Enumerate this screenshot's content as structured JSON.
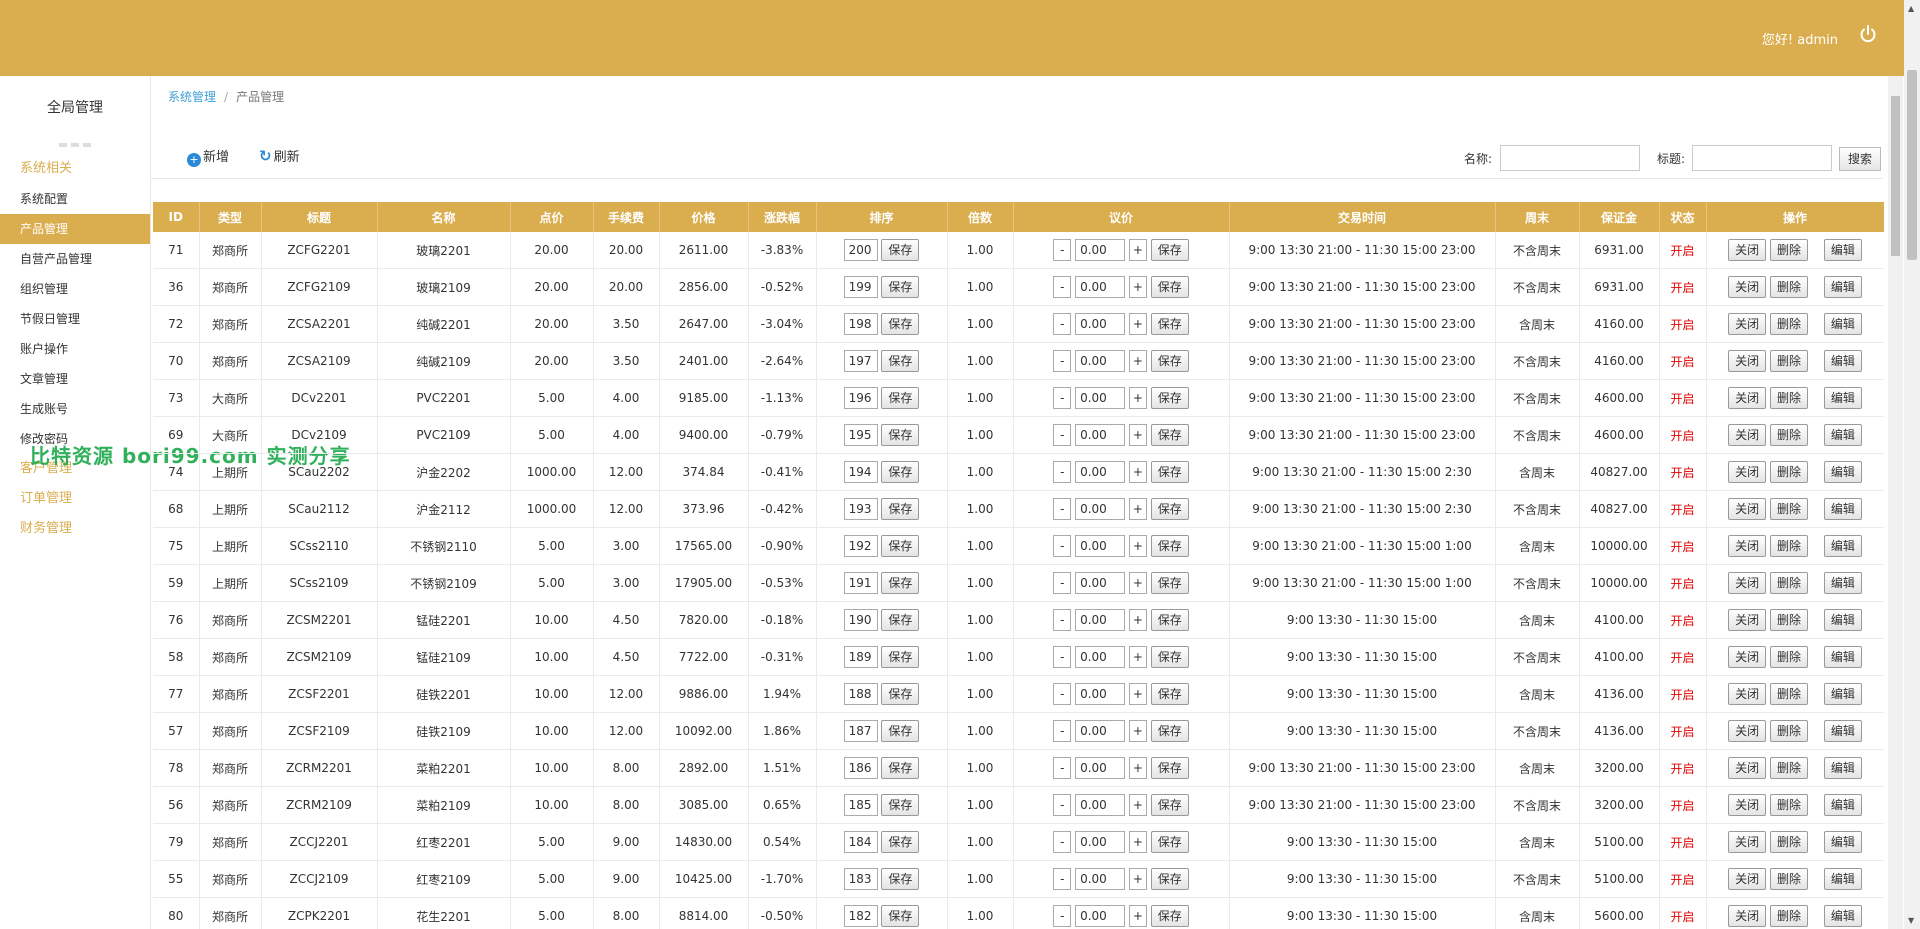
{
  "header": {
    "greeting": "您好! admin",
    "colors": {
      "accent": "#daae4f",
      "link": "#3f9fd6",
      "status_on": "#e10000"
    }
  },
  "sidebar": {
    "title": "全局管理",
    "groups": [
      {
        "label": "系统相关",
        "items": [
          {
            "label": "系统配置"
          },
          {
            "label": "产品管理",
            "active": true
          },
          {
            "label": "自营产品管理"
          },
          {
            "label": "组织管理"
          },
          {
            "label": "节假日管理"
          },
          {
            "label": "账户操作"
          },
          {
            "label": "文章管理"
          },
          {
            "label": "生成账号"
          },
          {
            "label": "修改密码"
          }
        ]
      },
      {
        "label": "客户管理",
        "items": []
      },
      {
        "label": "订单管理",
        "items": []
      },
      {
        "label": "财务管理",
        "items": []
      }
    ]
  },
  "watermark": "比特资源 bori99.com 实测分享",
  "breadcrumb": {
    "parent": "系统管理",
    "current": "产品管理"
  },
  "toolbar": {
    "add": "新增",
    "refresh": "刷新",
    "name_label": "名称:",
    "title_label": "标题:",
    "search": "搜索"
  },
  "table": {
    "headers": [
      "ID",
      "类型",
      "标题",
      "名称",
      "点价",
      "手续费",
      "价格",
      "涨跌幅",
      "排序",
      "倍数",
      "议价",
      "交易时间",
      "周末",
      "保证金",
      "状态",
      "操作"
    ],
    "labels": {
      "save": "保存",
      "close": "关闭",
      "delete": "删除",
      "edit": "编辑",
      "minus": "-",
      "plus": "+"
    },
    "rows": [
      [
        "71",
        "郑商所",
        "ZCFG2201",
        "玻璃2201",
        "20.00",
        "20.00",
        "2611.00",
        "-3.83%",
        "200",
        "1.00",
        "0.00",
        "9:00 13:30 21:00 - 11:30 15:00 23:00",
        "不含周末",
        "6931.00",
        "开启"
      ],
      [
        "36",
        "郑商所",
        "ZCFG2109",
        "玻璃2109",
        "20.00",
        "20.00",
        "2856.00",
        "-0.52%",
        "199",
        "1.00",
        "0.00",
        "9:00 13:30 21:00 - 11:30 15:00 23:00",
        "不含周末",
        "6931.00",
        "开启"
      ],
      [
        "72",
        "郑商所",
        "ZCSA2201",
        "纯碱2201",
        "20.00",
        "3.50",
        "2647.00",
        "-3.04%",
        "198",
        "1.00",
        "0.00",
        "9:00 13:30 21:00 - 11:30 15:00 23:00",
        "含周末",
        "4160.00",
        "开启"
      ],
      [
        "70",
        "郑商所",
        "ZCSA2109",
        "纯碱2109",
        "20.00",
        "3.50",
        "2401.00",
        "-2.64%",
        "197",
        "1.00",
        "0.00",
        "9:00 13:30 21:00 - 11:30 15:00 23:00",
        "不含周末",
        "4160.00",
        "开启"
      ],
      [
        "73",
        "大商所",
        "DCv2201",
        "PVC2201",
        "5.00",
        "4.00",
        "9185.00",
        "-1.13%",
        "196",
        "1.00",
        "0.00",
        "9:00 13:30 21:00 - 11:30 15:00 23:00",
        "不含周末",
        "4600.00",
        "开启"
      ],
      [
        "69",
        "大商所",
        "DCv2109",
        "PVC2109",
        "5.00",
        "4.00",
        "9400.00",
        "-0.79%",
        "195",
        "1.00",
        "0.00",
        "9:00 13:30 21:00 - 11:30 15:00 23:00",
        "不含周末",
        "4600.00",
        "开启"
      ],
      [
        "74",
        "上期所",
        "SCau2202",
        "沪金2202",
        "1000.00",
        "12.00",
        "374.84",
        "-0.41%",
        "194",
        "1.00",
        "0.00",
        "9:00 13:30 21:00 - 11:30 15:00 2:30",
        "含周末",
        "40827.00",
        "开启"
      ],
      [
        "68",
        "上期所",
        "SCau2112",
        "沪金2112",
        "1000.00",
        "12.00",
        "373.96",
        "-0.42%",
        "193",
        "1.00",
        "0.00",
        "9:00 13:30 21:00 - 11:30 15:00 2:30",
        "不含周末",
        "40827.00",
        "开启"
      ],
      [
        "75",
        "上期所",
        "SCss2110",
        "不锈钢2110",
        "5.00",
        "3.00",
        "17565.00",
        "-0.90%",
        "192",
        "1.00",
        "0.00",
        "9:00 13:30 21:00 - 11:30 15:00 1:00",
        "含周末",
        "10000.00",
        "开启"
      ],
      [
        "59",
        "上期所",
        "SCss2109",
        "不锈钢2109",
        "5.00",
        "3.00",
        "17905.00",
        "-0.53%",
        "191",
        "1.00",
        "0.00",
        "9:00 13:30 21:00 - 11:30 15:00 1:00",
        "不含周末",
        "10000.00",
        "开启"
      ],
      [
        "76",
        "郑商所",
        "ZCSM2201",
        "锰硅2201",
        "10.00",
        "4.50",
        "7820.00",
        "-0.18%",
        "190",
        "1.00",
        "0.00",
        "9:00 13:30 - 11:30 15:00",
        "含周末",
        "4100.00",
        "开启"
      ],
      [
        "58",
        "郑商所",
        "ZCSM2109",
        "锰硅2109",
        "10.00",
        "4.50",
        "7722.00",
        "-0.31%",
        "189",
        "1.00",
        "0.00",
        "9:00 13:30 - 11:30 15:00",
        "不含周末",
        "4100.00",
        "开启"
      ],
      [
        "77",
        "郑商所",
        "ZCSF2201",
        "硅铁2201",
        "10.00",
        "12.00",
        "9886.00",
        "1.94%",
        "188",
        "1.00",
        "0.00",
        "9:00 13:30 - 11:30 15:00",
        "含周末",
        "4136.00",
        "开启"
      ],
      [
        "57",
        "郑商所",
        "ZCSF2109",
        "硅铁2109",
        "10.00",
        "12.00",
        "10092.00",
        "1.86%",
        "187",
        "1.00",
        "0.00",
        "9:00 13:30 - 11:30 15:00",
        "不含周末",
        "4136.00",
        "开启"
      ],
      [
        "78",
        "郑商所",
        "ZCRM2201",
        "菜粕2201",
        "10.00",
        "8.00",
        "2892.00",
        "1.51%",
        "186",
        "1.00",
        "0.00",
        "9:00 13:30 21:00 - 11:30 15:00 23:00",
        "含周末",
        "3200.00",
        "开启"
      ],
      [
        "56",
        "郑商所",
        "ZCRM2109",
        "菜粕2109",
        "10.00",
        "8.00",
        "3085.00",
        "0.65%",
        "185",
        "1.00",
        "0.00",
        "9:00 13:30 21:00 - 11:30 15:00 23:00",
        "不含周末",
        "3200.00",
        "开启"
      ],
      [
        "79",
        "郑商所",
        "ZCCJ2201",
        "红枣2201",
        "5.00",
        "9.00",
        "14830.00",
        "0.54%",
        "184",
        "1.00",
        "0.00",
        "9:00 13:30 - 11:30 15:00",
        "含周末",
        "5100.00",
        "开启"
      ],
      [
        "55",
        "郑商所",
        "ZCCJ2109",
        "红枣2109",
        "5.00",
        "9.00",
        "10425.00",
        "-1.70%",
        "183",
        "1.00",
        "0.00",
        "9:00 13:30 - 11:30 15:00",
        "不含周末",
        "5100.00",
        "开启"
      ],
      [
        "80",
        "郑商所",
        "ZCPK2201",
        "花生2201",
        "5.00",
        "8.00",
        "8814.00",
        "-0.50%",
        "182",
        "1.00",
        "0.00",
        "9:00 13:30 - 11:30 15:00",
        "含周末",
        "5600.00",
        "开启"
      ]
    ]
  }
}
